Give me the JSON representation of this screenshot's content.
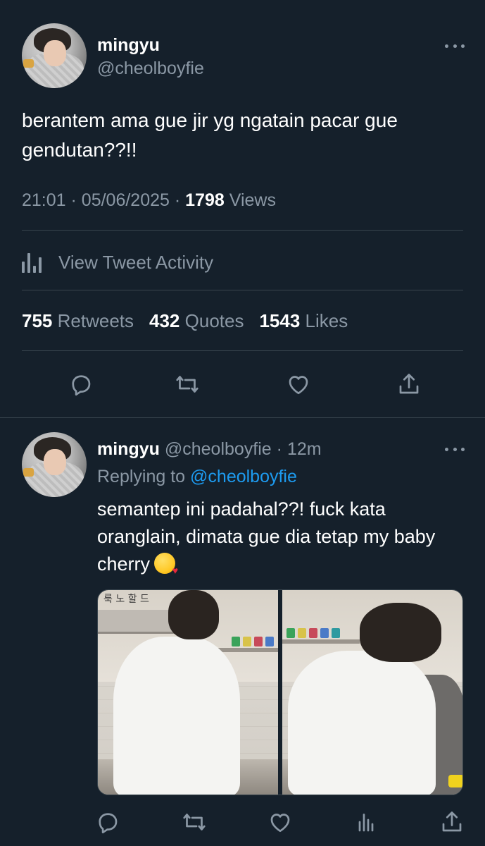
{
  "main_tweet": {
    "display_name": "mingyu",
    "handle": "@cheolboyfie",
    "text": "berantem ama gue jir yg ngatain pacar gue gendutan??!!",
    "time": "21:01",
    "date": "05/06/2025",
    "views_count": "1798",
    "views_label": "Views",
    "activity_label": "View Tweet Activity",
    "stats": [
      {
        "count": "755",
        "label": "Retweets"
      },
      {
        "count": "432",
        "label": "Quotes"
      },
      {
        "count": "1543",
        "label": "Likes"
      }
    ],
    "actions": [
      "reply-icon",
      "retweet-icon",
      "like-icon",
      "share-icon"
    ]
  },
  "reply_tweet": {
    "display_name": "mingyu",
    "handle": "@cheolboyfie",
    "time_ago": "12m",
    "replying_prefix": "Replying to",
    "replying_to": "@cheolboyfie",
    "text": "semantep ini padahal??! fuck kata oranglain, dimata gue dia tetap my baby cherry",
    "emoji": "kissing-face-with-heart",
    "media_sign_text": "룩 노 할 드",
    "actions": [
      "reply-icon",
      "retweet-icon",
      "like-icon",
      "analytics-icon",
      "share-icon"
    ]
  },
  "colors": {
    "background": "#15202b",
    "text": "#ffffff",
    "muted": "#8b98a5",
    "link": "#1d9bf0",
    "divider": "#38444d"
  }
}
